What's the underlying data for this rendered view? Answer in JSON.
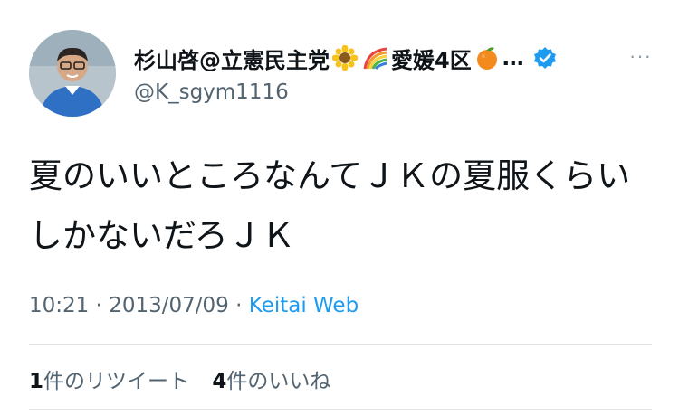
{
  "user": {
    "display_name": "杉山啓@立憲民主党",
    "display_name_suffix": "愛媛4区",
    "ellipsis": "…",
    "handle": "@K_sgym1116",
    "verified_color": "#1d9bf0",
    "avatar_icon": "profile-photo"
  },
  "more_label": "···",
  "tweet": {
    "text": "夏のいいところなんてＪＫの夏服くらいしかないだろＪＫ",
    "time": "10:21",
    "date": "2013/07/09",
    "separator": " · ",
    "source": "Keitai Web"
  },
  "stats": {
    "retweets_count": "1",
    "retweets_label": "件のリツイート",
    "likes_count": "4",
    "likes_label": "件のいいね"
  },
  "colors": {
    "text": "#0f1419",
    "secondary": "#536471",
    "link": "#1d9bf0",
    "divider": "#dfe4e8"
  }
}
